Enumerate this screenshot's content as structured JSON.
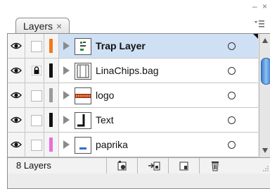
{
  "window": {
    "minimize_glyph": "–",
    "close_glyph": "×"
  },
  "tab": {
    "label": "Layers",
    "close_glyph": "×"
  },
  "panel_menu": {
    "icon": "panel-menu-icon"
  },
  "layers": [
    {
      "name": "Trap Layer",
      "color": "#f07a18",
      "selected": true,
      "locked": false,
      "thumb": "trap"
    },
    {
      "name": "LinaChips.bag",
      "color": "#111111",
      "selected": false,
      "locked": true,
      "thumb": "bag"
    },
    {
      "name": "logo",
      "color": "#9a9a9a",
      "selected": false,
      "locked": false,
      "thumb": "logo"
    },
    {
      "name": "Text",
      "color": "#111111",
      "selected": false,
      "locked": false,
      "thumb": "text"
    },
    {
      "name": "paprika",
      "color": "#ea6be0",
      "selected": false,
      "locked": false,
      "thumb": "paprika"
    }
  ],
  "footer": {
    "layer_count": "8 Layers",
    "buttons": [
      "locate-object-icon",
      "move-to-layer-icon",
      "new-layer-icon",
      "delete-layer-icon"
    ]
  }
}
